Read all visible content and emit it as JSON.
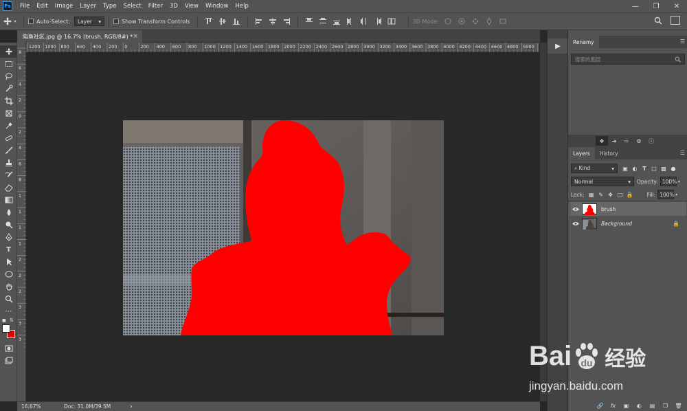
{
  "menubar": {
    "logo": "Ps",
    "items": [
      "File",
      "Edit",
      "Image",
      "Layer",
      "Type",
      "Select",
      "Filter",
      "3D",
      "View",
      "Window",
      "Help"
    ],
    "window_controls": [
      "minimize-icon",
      "restore-icon",
      "close-icon"
    ]
  },
  "options": {
    "auto_select_label": "Auto-Select:",
    "auto_select_value": "Layer",
    "transform_label": "Show Transform Controls",
    "mode_3d_label": "3D Mode:"
  },
  "document": {
    "tab_title": "陷鱼社区.jpg @ 16.7% (brush, RGB/8#) *",
    "tab_close": "×"
  },
  "ruler_top": [
    "1200",
    "1000",
    "800",
    "600",
    "400",
    "200",
    "0",
    "200",
    "400",
    "600",
    "800",
    "1000",
    "1200",
    "1400",
    "1600",
    "1800",
    "2000",
    "2200",
    "2400",
    "2600",
    "2800",
    "3000",
    "3200",
    "3400",
    "3600",
    "3800",
    "4000",
    "4200",
    "4400",
    "4600",
    "4800",
    "5000",
    "5"
  ],
  "ruler_left": [
    "8",
    "6",
    "4",
    "2",
    "0",
    "2",
    "4",
    "6",
    "8",
    "1",
    "1",
    "1",
    "1",
    "2",
    "2",
    "2",
    "3",
    "3",
    "3"
  ],
  "status": {
    "zoom": "16.67%",
    "doc": "Doc: 31.0M/39.5M",
    "arrow": "›"
  },
  "renamy": {
    "title": "Renamy",
    "search_placeholder": "搜索的图层"
  },
  "layers_panel": {
    "tabs": [
      "Layers",
      "History"
    ],
    "filter_label": "Kind",
    "blend_mode": "Normal",
    "opacity_label": "Opacity:",
    "opacity_value": "100%",
    "lock_label": "Lock:",
    "fill_label": "Fill:",
    "fill_value": "100%",
    "layers": [
      {
        "name": "brush",
        "selected": true
      },
      {
        "name": "Background",
        "selected": false
      }
    ]
  },
  "watermark": {
    "brand": "Bai",
    "brand2": "经验",
    "url": "jingyan.baidu.com"
  },
  "colors": {
    "accent": "#31a8ff",
    "mask_red": "#ff0000",
    "foreground": "#ffffff",
    "background": "#e00000"
  }
}
